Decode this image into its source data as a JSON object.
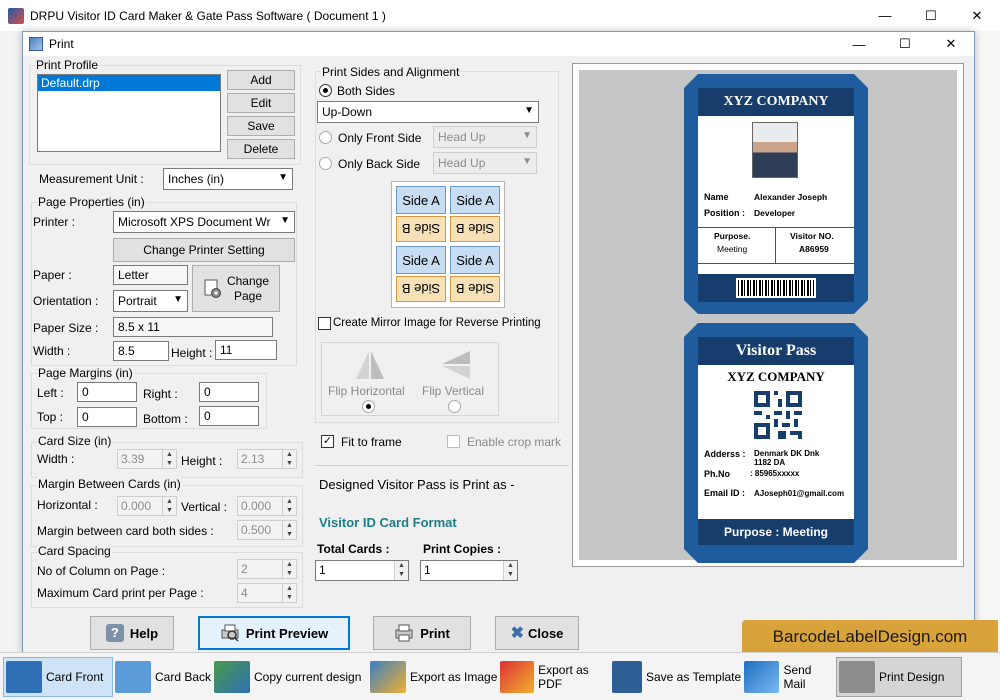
{
  "app": {
    "title": "DRPU Visitor ID Card Maker & Gate Pass Software ( Document 1 )",
    "window_buttons": [
      "—",
      "☐",
      "✕"
    ]
  },
  "dialog": {
    "title": "Print",
    "print_profile": {
      "label": "Print Profile",
      "items": [
        "Default.drp"
      ],
      "buttons": [
        "Add",
        "Edit",
        "Save",
        "Delete"
      ]
    },
    "measurement_unit": {
      "label": "Measurement Unit :",
      "value": "Inches (in)"
    },
    "page_properties": {
      "label": "Page Properties (in)",
      "printer_label": "Printer :",
      "printer_value": "Microsoft XPS Document Wr",
      "change_printer_button": "Change Printer Setting",
      "paper_label": "Paper :",
      "paper_value": "Letter",
      "orientation_label": "Orientation :",
      "orientation_value": "Portrait",
      "change_page_button_line1": "Change",
      "change_page_button_line2": "Page",
      "paper_size_label": "Paper Size :",
      "paper_size_value": "8.5 x 11",
      "width_label": "Width :",
      "width_value": "8.5",
      "height_label": "Height :",
      "height_value": "11"
    },
    "page_margins": {
      "label": "Page Margins (in)",
      "left_label": "Left :",
      "left_value": "0",
      "right_label": "Right :",
      "right_value": "0",
      "top_label": "Top :",
      "top_value": "0",
      "bottom_label": "Bottom :",
      "bottom_value": "0"
    },
    "card_size": {
      "label": "Card Size (in)",
      "width_label": "Width :",
      "width_value": "3.39",
      "height_label": "Height :",
      "height_value": "2.13"
    },
    "margin_between_cards": {
      "label": "Margin Between Cards (in)",
      "horizontal_label": "Horizontal :",
      "horizontal_value": "0.000",
      "vertical_label": "Vertical :",
      "vertical_value": "0.000",
      "both_sides_label": "Margin between card both sides :",
      "both_sides_value": "0.500"
    },
    "card_spacing": {
      "label": "Card Spacing",
      "columns_label": "No of Column on Page :",
      "columns_value": "2",
      "max_label": "Maximum Card print per Page :",
      "max_value": "4"
    },
    "print_sides": {
      "label": "Print Sides and Alignment",
      "both_sides": "Both Sides",
      "both_sides_value": "Up-Down",
      "only_front": "Only Front Side",
      "only_front_value": "Head Up",
      "only_back": "Only Back Side",
      "only_back_value": "Head Up",
      "side_a": "Side A",
      "side_b": "Side B",
      "mirror_label": "Create Mirror Image for Reverse Printing",
      "flip_horizontal": "Flip Horizontal",
      "flip_vertical": "Flip Vertical"
    },
    "fit_to_frame": "Fit to frame",
    "enable_crop_mark": "Enable crop mark",
    "print_as_text": "Designed Visitor Pass is Print as -",
    "format_text": "Visitor ID Card Format",
    "total_cards_label": "Total Cards :",
    "total_cards_value": "1",
    "print_copies_label": "Print Copies :",
    "print_copies_value": "1",
    "buttons": {
      "help": "Help",
      "print_preview": "Print Preview",
      "print": "Print",
      "close": "Close"
    }
  },
  "preview": {
    "front": {
      "company": "XYZ COMPANY",
      "name_label": "Name",
      "name_value": "Alexander Joseph",
      "position_label": "Position :",
      "position_value": "Developer",
      "purpose_label": "Purpose.",
      "purpose_value": "Meeting",
      "visitor_no_label": "Visitor NO.",
      "visitor_no_value": "A86959"
    },
    "back": {
      "title": "Visitor Pass",
      "company": "XYZ COMPANY",
      "address_label": "Adderss :",
      "address_value_1": "Denmark DK Dnk",
      "address_value_2": "1182 DA",
      "phone_label": "Ph.No",
      "phone_value": ": 85965xxxxx",
      "email_label": "Email ID :",
      "email_value": "AJoseph01@gmail.com",
      "purpose": "Purpose : Meeting"
    },
    "colors": {
      "card_blue": "#1f5c9e",
      "header_navy": "#163d6b"
    }
  },
  "brand": "BarcodeLabelDesign.com",
  "toolbar": {
    "items": [
      {
        "label": "Card Front",
        "icon": "card-front-icon"
      },
      {
        "label": "Card Back",
        "icon": "card-back-icon"
      },
      {
        "label": "Copy current design",
        "icon": "copy-design-icon"
      },
      {
        "label": "Export as Image",
        "icon": "export-image-icon"
      },
      {
        "label": "Export as PDF",
        "icon": "export-pdf-icon"
      },
      {
        "label": "Save as Template",
        "icon": "save-template-icon"
      },
      {
        "label": "Send Mail",
        "icon": "send-mail-icon"
      },
      {
        "label": "Print Design",
        "icon": "print-design-icon"
      }
    ]
  }
}
